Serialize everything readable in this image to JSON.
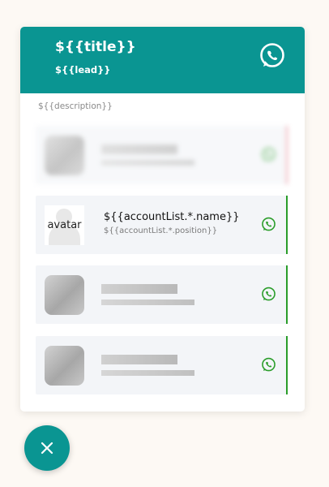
{
  "header": {
    "title": "${{title}}",
    "lead": "${{lead}}",
    "icon": "whatsapp-icon",
    "background": "#0a9592"
  },
  "description": "${{description}}",
  "accounts": [
    {
      "avatar_label": "avatar",
      "avatar_caption": "",
      "name": "${{accountList.*.name}}",
      "position": "${{accountList.*.position}}",
      "icon": "whatsapp-icon"
    }
  ],
  "colors": {
    "accent": "#0a9592",
    "whatsapp_green": "#2a9d2a",
    "blurred_accent": "#e87d8a",
    "card_background": "#f3f5f8"
  },
  "fab": {
    "icon": "close-icon"
  }
}
